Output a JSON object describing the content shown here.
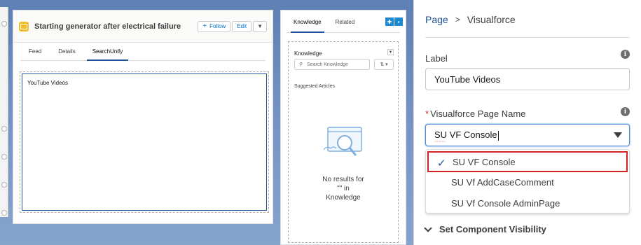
{
  "record": {
    "title": "Starting generator after electrical failure",
    "follow_label": "Follow",
    "edit_label": "Edit"
  },
  "record_tabs": [
    "Feed",
    "Details",
    "SearchUnify"
  ],
  "visualforce_component": {
    "label": "YouTube Videos"
  },
  "sidebar_tabs": [
    "Knowledge",
    "Related"
  ],
  "knowledge": {
    "title": "Knowledge",
    "search_placeholder": "Search Knowledge",
    "suggested_label": "Suggested Articles",
    "empty_line1": "No results for",
    "empty_line2": "\"\" in",
    "empty_line3": "Knowledge"
  },
  "panel": {
    "breadcrumb_parent": "Page",
    "breadcrumb_separator": ">",
    "breadcrumb_current": "Visualforce",
    "label_field": {
      "label": "Label",
      "value": "YouTube Videos"
    },
    "page_name_field": {
      "required_marker": "*",
      "label": "Visualforce Page Name",
      "value": "SU VF Console"
    },
    "options": [
      "SU VF Console",
      "SU Vf AddCaseComment",
      "SU Vf Console AdminPage"
    ],
    "selected_option": "SU VF Console",
    "visibility_section": "Set Component Visibility"
  },
  "colors": {
    "brand_blue": "#1b5297",
    "highlight_red": "#d3242a",
    "canvas_blue": "#6f8fbf"
  },
  "icons": {
    "info": "info-icon",
    "check": "checkmark-icon",
    "dropdown": "chevron-down-icon",
    "search": "search-icon"
  }
}
